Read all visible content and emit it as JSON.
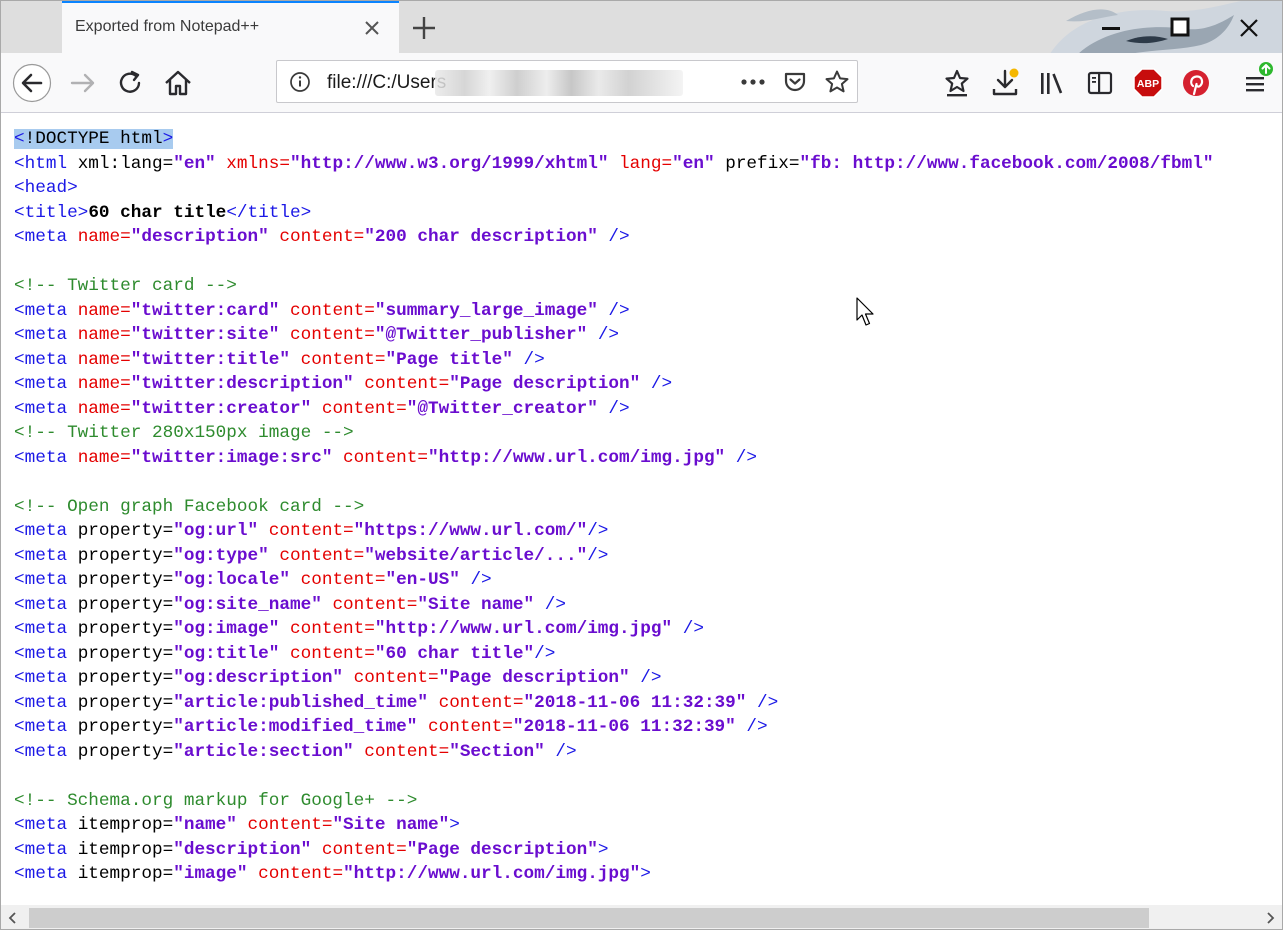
{
  "tab": {
    "title": "Exported from Notepad++"
  },
  "urlbar": {
    "url": "file:///C:/Users"
  },
  "source_lines": [
    [
      {
        "s": "<",
        "c": "t sel"
      },
      {
        "s": "!DOCTYPE html",
        "c": "ab sel"
      },
      {
        "s": ">",
        "c": "t sel"
      }
    ],
    [
      {
        "s": "<html ",
        "c": "t"
      },
      {
        "s": "xml:lang=",
        "c": "ab"
      },
      {
        "s": "\"en\"",
        "c": "v"
      },
      {
        "s": " xmlns=",
        "c": "a"
      },
      {
        "s": "\"http://www.w3.org/1999/xhtml\"",
        "c": "v"
      },
      {
        "s": " lang=",
        "c": "a"
      },
      {
        "s": "\"en\"",
        "c": "v"
      },
      {
        "s": " prefix=",
        "c": "ab"
      },
      {
        "s": "\"fb: http://www.facebook.com/2008/fbml\"",
        "c": "v"
      }
    ],
    [
      {
        "s": "<head>",
        "c": "t"
      }
    ],
    [
      {
        "s": "<title>",
        "c": "t"
      },
      {
        "s": "60 char title",
        "c": "x"
      },
      {
        "s": "</title>",
        "c": "t"
      }
    ],
    [
      {
        "s": "<meta ",
        "c": "t"
      },
      {
        "s": "name=",
        "c": "a"
      },
      {
        "s": "\"description\"",
        "c": "v"
      },
      {
        "s": " content=",
        "c": "a"
      },
      {
        "s": "\"200 char description\"",
        "c": "v"
      },
      {
        "s": " />",
        "c": "t"
      }
    ],
    [],
    [
      {
        "s": "<!-- Twitter card -->",
        "c": "c"
      }
    ],
    [
      {
        "s": "<meta ",
        "c": "t"
      },
      {
        "s": "name=",
        "c": "a"
      },
      {
        "s": "\"twitter:card\"",
        "c": "v"
      },
      {
        "s": " content=",
        "c": "a"
      },
      {
        "s": "\"summary_large_image\"",
        "c": "v"
      },
      {
        "s": " />",
        "c": "t"
      }
    ],
    [
      {
        "s": "<meta ",
        "c": "t"
      },
      {
        "s": "name=",
        "c": "a"
      },
      {
        "s": "\"twitter:site\"",
        "c": "v"
      },
      {
        "s": " content=",
        "c": "a"
      },
      {
        "s": "\"@Twitter_publisher\"",
        "c": "v"
      },
      {
        "s": " />",
        "c": "t"
      }
    ],
    [
      {
        "s": "<meta ",
        "c": "t"
      },
      {
        "s": "name=",
        "c": "a"
      },
      {
        "s": "\"twitter:title\"",
        "c": "v"
      },
      {
        "s": " content=",
        "c": "a"
      },
      {
        "s": "\"Page title\"",
        "c": "v"
      },
      {
        "s": " />",
        "c": "t"
      }
    ],
    [
      {
        "s": "<meta ",
        "c": "t"
      },
      {
        "s": "name=",
        "c": "a"
      },
      {
        "s": "\"twitter:description\"",
        "c": "v"
      },
      {
        "s": " content=",
        "c": "a"
      },
      {
        "s": "\"Page description\"",
        "c": "v"
      },
      {
        "s": " />",
        "c": "t"
      }
    ],
    [
      {
        "s": "<meta ",
        "c": "t"
      },
      {
        "s": "name=",
        "c": "a"
      },
      {
        "s": "\"twitter:creator\"",
        "c": "v"
      },
      {
        "s": " content=",
        "c": "a"
      },
      {
        "s": "\"@Twitter_creator\"",
        "c": "v"
      },
      {
        "s": " />",
        "c": "t"
      }
    ],
    [
      {
        "s": "<!-- Twitter 280x150px image -->",
        "c": "c"
      }
    ],
    [
      {
        "s": "<meta ",
        "c": "t"
      },
      {
        "s": "name=",
        "c": "a"
      },
      {
        "s": "\"twitter:image:src\"",
        "c": "v"
      },
      {
        "s": " content=",
        "c": "a"
      },
      {
        "s": "\"http://www.url.com/img.jpg\"",
        "c": "v"
      },
      {
        "s": " />",
        "c": "t"
      }
    ],
    [],
    [
      {
        "s": "<!-- Open graph Facebook card -->",
        "c": "c"
      }
    ],
    [
      {
        "s": "<meta ",
        "c": "t"
      },
      {
        "s": "property=",
        "c": "ab"
      },
      {
        "s": "\"og:url\"",
        "c": "v"
      },
      {
        "s": " content=",
        "c": "a"
      },
      {
        "s": "\"https://www.url.com/\"",
        "c": "v"
      },
      {
        "s": "/>",
        "c": "t"
      }
    ],
    [
      {
        "s": "<meta ",
        "c": "t"
      },
      {
        "s": "property=",
        "c": "ab"
      },
      {
        "s": "\"og:type\"",
        "c": "v"
      },
      {
        "s": " content=",
        "c": "a"
      },
      {
        "s": "\"website/article/...\"",
        "c": "v"
      },
      {
        "s": "/>",
        "c": "t"
      }
    ],
    [
      {
        "s": "<meta ",
        "c": "t"
      },
      {
        "s": "property=",
        "c": "ab"
      },
      {
        "s": "\"og:locale\"",
        "c": "v"
      },
      {
        "s": " content=",
        "c": "a"
      },
      {
        "s": "\"en-US\"",
        "c": "v"
      },
      {
        "s": " />",
        "c": "t"
      }
    ],
    [
      {
        "s": "<meta ",
        "c": "t"
      },
      {
        "s": "property=",
        "c": "ab"
      },
      {
        "s": "\"og:site_name\"",
        "c": "v"
      },
      {
        "s": " content=",
        "c": "a"
      },
      {
        "s": "\"Site name\"",
        "c": "v"
      },
      {
        "s": " />",
        "c": "t"
      }
    ],
    [
      {
        "s": "<meta ",
        "c": "t"
      },
      {
        "s": "property=",
        "c": "ab"
      },
      {
        "s": "\"og:image\"",
        "c": "v"
      },
      {
        "s": " content=",
        "c": "a"
      },
      {
        "s": "\"http://www.url.com/img.jpg\"",
        "c": "v"
      },
      {
        "s": " />",
        "c": "t"
      }
    ],
    [
      {
        "s": "<meta ",
        "c": "t"
      },
      {
        "s": "property=",
        "c": "ab"
      },
      {
        "s": "\"og:title\"",
        "c": "v"
      },
      {
        "s": " content=",
        "c": "a"
      },
      {
        "s": "\"60 char title\"",
        "c": "v"
      },
      {
        "s": "/>",
        "c": "t"
      }
    ],
    [
      {
        "s": "<meta ",
        "c": "t"
      },
      {
        "s": "property=",
        "c": "ab"
      },
      {
        "s": "\"og:description\"",
        "c": "v"
      },
      {
        "s": " content=",
        "c": "a"
      },
      {
        "s": "\"Page description\"",
        "c": "v"
      },
      {
        "s": " />",
        "c": "t"
      }
    ],
    [
      {
        "s": "<meta ",
        "c": "t"
      },
      {
        "s": "property=",
        "c": "ab"
      },
      {
        "s": "\"article:published_time\"",
        "c": "v"
      },
      {
        "s": " content=",
        "c": "a"
      },
      {
        "s": "\"2018-11-06 11:32:39\"",
        "c": "v"
      },
      {
        "s": " />",
        "c": "t"
      }
    ],
    [
      {
        "s": "<meta ",
        "c": "t"
      },
      {
        "s": "property=",
        "c": "ab"
      },
      {
        "s": "\"article:modified_time\"",
        "c": "v"
      },
      {
        "s": " content=",
        "c": "a"
      },
      {
        "s": "\"2018-11-06 11:32:39\"",
        "c": "v"
      },
      {
        "s": " />",
        "c": "t"
      }
    ],
    [
      {
        "s": "<meta ",
        "c": "t"
      },
      {
        "s": "property=",
        "c": "ab"
      },
      {
        "s": "\"article:section\"",
        "c": "v"
      },
      {
        "s": " content=",
        "c": "a"
      },
      {
        "s": "\"Section\"",
        "c": "v"
      },
      {
        "s": " />",
        "c": "t"
      }
    ],
    [],
    [
      {
        "s": "<!-- Schema.org markup for Google+ -->",
        "c": "c"
      }
    ],
    [
      {
        "s": "<meta ",
        "c": "t"
      },
      {
        "s": "itemprop=",
        "c": "ab"
      },
      {
        "s": "\"name\"",
        "c": "v"
      },
      {
        "s": " content=",
        "c": "a"
      },
      {
        "s": "\"Site name\"",
        "c": "v"
      },
      {
        "s": ">",
        "c": "t"
      }
    ],
    [
      {
        "s": "<meta ",
        "c": "t"
      },
      {
        "s": "itemprop=",
        "c": "ab"
      },
      {
        "s": "\"description\"",
        "c": "v"
      },
      {
        "s": " content=",
        "c": "a"
      },
      {
        "s": "\"Page description\"",
        "c": "v"
      },
      {
        "s": ">",
        "c": "t"
      }
    ],
    [
      {
        "s": "<meta ",
        "c": "t"
      },
      {
        "s": "itemprop=",
        "c": "ab"
      },
      {
        "s": "\"image\"",
        "c": "v"
      },
      {
        "s": " content=",
        "c": "a"
      },
      {
        "s": "\"http://www.url.com/img.jpg\"",
        "c": "v"
      },
      {
        "s": ">",
        "c": "t"
      }
    ]
  ],
  "colors": {
    "tag": "#1b18e6",
    "attribute": "#e40000",
    "value": "#6a0dcf",
    "comment": "#2e8b2e",
    "selection": "#a8cbef",
    "tab_accent": "#0a84ff",
    "abp": "#c70d0d",
    "pinterest": "#d5212f",
    "update": "#2eb82e"
  },
  "icons": {
    "back": "back-arrow-icon",
    "forward": "forward-arrow-icon",
    "reload": "reload-icon",
    "home": "home-icon",
    "info": "info-icon",
    "page_actions": "ellipsis-icon",
    "pocket": "pocket-icon",
    "bookmark": "star-icon",
    "bookmarks_menu": "star-list-icon",
    "downloads": "download-icon",
    "library": "library-icon",
    "sidebar": "sidebar-icon",
    "adblock": "abp-icon",
    "pinterest": "pinterest-icon",
    "menu": "hamburger-icon"
  },
  "extensions": {
    "adblock_label": "ABP"
  }
}
